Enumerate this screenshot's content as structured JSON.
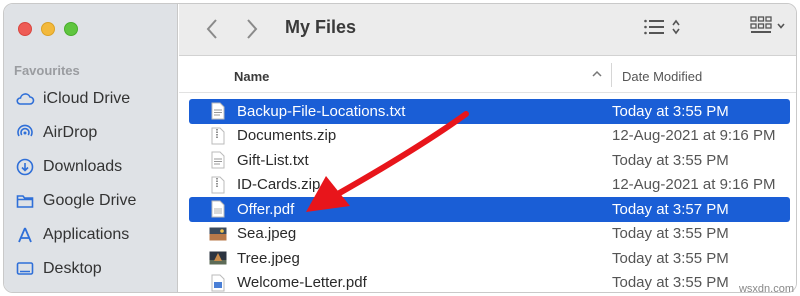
{
  "window": {
    "title": "My Files"
  },
  "sidebar": {
    "heading": "Favourites",
    "items": [
      {
        "label": "iCloud Drive",
        "icon": "cloud-icon"
      },
      {
        "label": "AirDrop",
        "icon": "airdrop-icon"
      },
      {
        "label": "Downloads",
        "icon": "download-icon"
      },
      {
        "label": "Google Drive",
        "icon": "folder-icon"
      },
      {
        "label": "Applications",
        "icon": "applications-icon"
      },
      {
        "label": "Desktop",
        "icon": "desktop-icon"
      }
    ]
  },
  "columns": {
    "name": "Name",
    "date": "Date Modified"
  },
  "files": [
    {
      "name": "Backup-File-Locations.txt",
      "date": "Today at 3:55 PM",
      "selected": true,
      "icon": "text-file-icon"
    },
    {
      "name": "Documents.zip",
      "date": "12-Aug-2021 at 9:16 PM",
      "selected": false,
      "icon": "zip-file-icon"
    },
    {
      "name": "Gift-List.txt",
      "date": "Today at 3:55 PM",
      "selected": false,
      "icon": "text-file-icon"
    },
    {
      "name": "ID-Cards.zip",
      "date": "12-Aug-2021 at 9:16 PM",
      "selected": false,
      "icon": "zip-file-icon"
    },
    {
      "name": "Offer.pdf",
      "date": "Today at 3:57 PM",
      "selected": true,
      "icon": "pdf-file-icon"
    },
    {
      "name": "Sea.jpeg",
      "date": "Today at 3:55 PM",
      "selected": false,
      "icon": "image-file-icon"
    },
    {
      "name": "Tree.jpeg",
      "date": "Today at 3:55 PM",
      "selected": false,
      "icon": "image-file-icon"
    },
    {
      "name": "Welcome-Letter.pdf",
      "date": "Today at 3:55 PM",
      "selected": false,
      "icon": "pdf-file-icon"
    }
  ],
  "colors": {
    "selection": "#1a5ed6",
    "sidebar_icon": "#2f6fd8",
    "annotation_arrow": "#e8151b"
  },
  "watermark": "wsxdn.com"
}
